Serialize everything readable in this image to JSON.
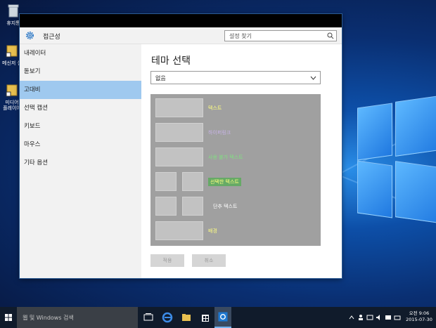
{
  "desktop": {
    "icons": [
      {
        "label": "휴지통"
      },
      {
        "label": "메신저 설"
      },
      {
        "label": "미디어\n플레이어"
      }
    ]
  },
  "window": {
    "app_title": "접근성",
    "search": {
      "placeholder": "설정 찾기"
    },
    "nav": [
      {
        "label": "내레이터",
        "active": false
      },
      {
        "label": "돋보기",
        "active": false
      },
      {
        "label": "고대비",
        "active": true
      },
      {
        "label": "선택 캡션",
        "active": false
      },
      {
        "label": "키보드",
        "active": false
      },
      {
        "label": "마우스",
        "active": false
      },
      {
        "label": "기타 옵션",
        "active": false
      }
    ],
    "main": {
      "title": "테마 선택",
      "theme_select": {
        "value": "없음"
      },
      "preview": {
        "text": "텍스트",
        "hyperlink": "하이퍼링크",
        "disabled": "사용 불가 텍스트",
        "selected": "선택한 텍스트",
        "button": "단추 텍스트",
        "background": "배경"
      },
      "apply_label": "적용",
      "cancel_label": "취소"
    }
  },
  "taskbar": {
    "search_placeholder": "웹 및 Windows 검색",
    "clock_time": "오전 9:06",
    "clock_date": "2015-07-30"
  },
  "colors": {
    "preview_text": "#ffff80",
    "preview_hyperlink": "#c8b4e8",
    "preview_disabled": "#80e080",
    "preview_selected_bg": "#66aa66",
    "preview_button_text": "#ffffff",
    "preview_background": "#ffff80"
  }
}
